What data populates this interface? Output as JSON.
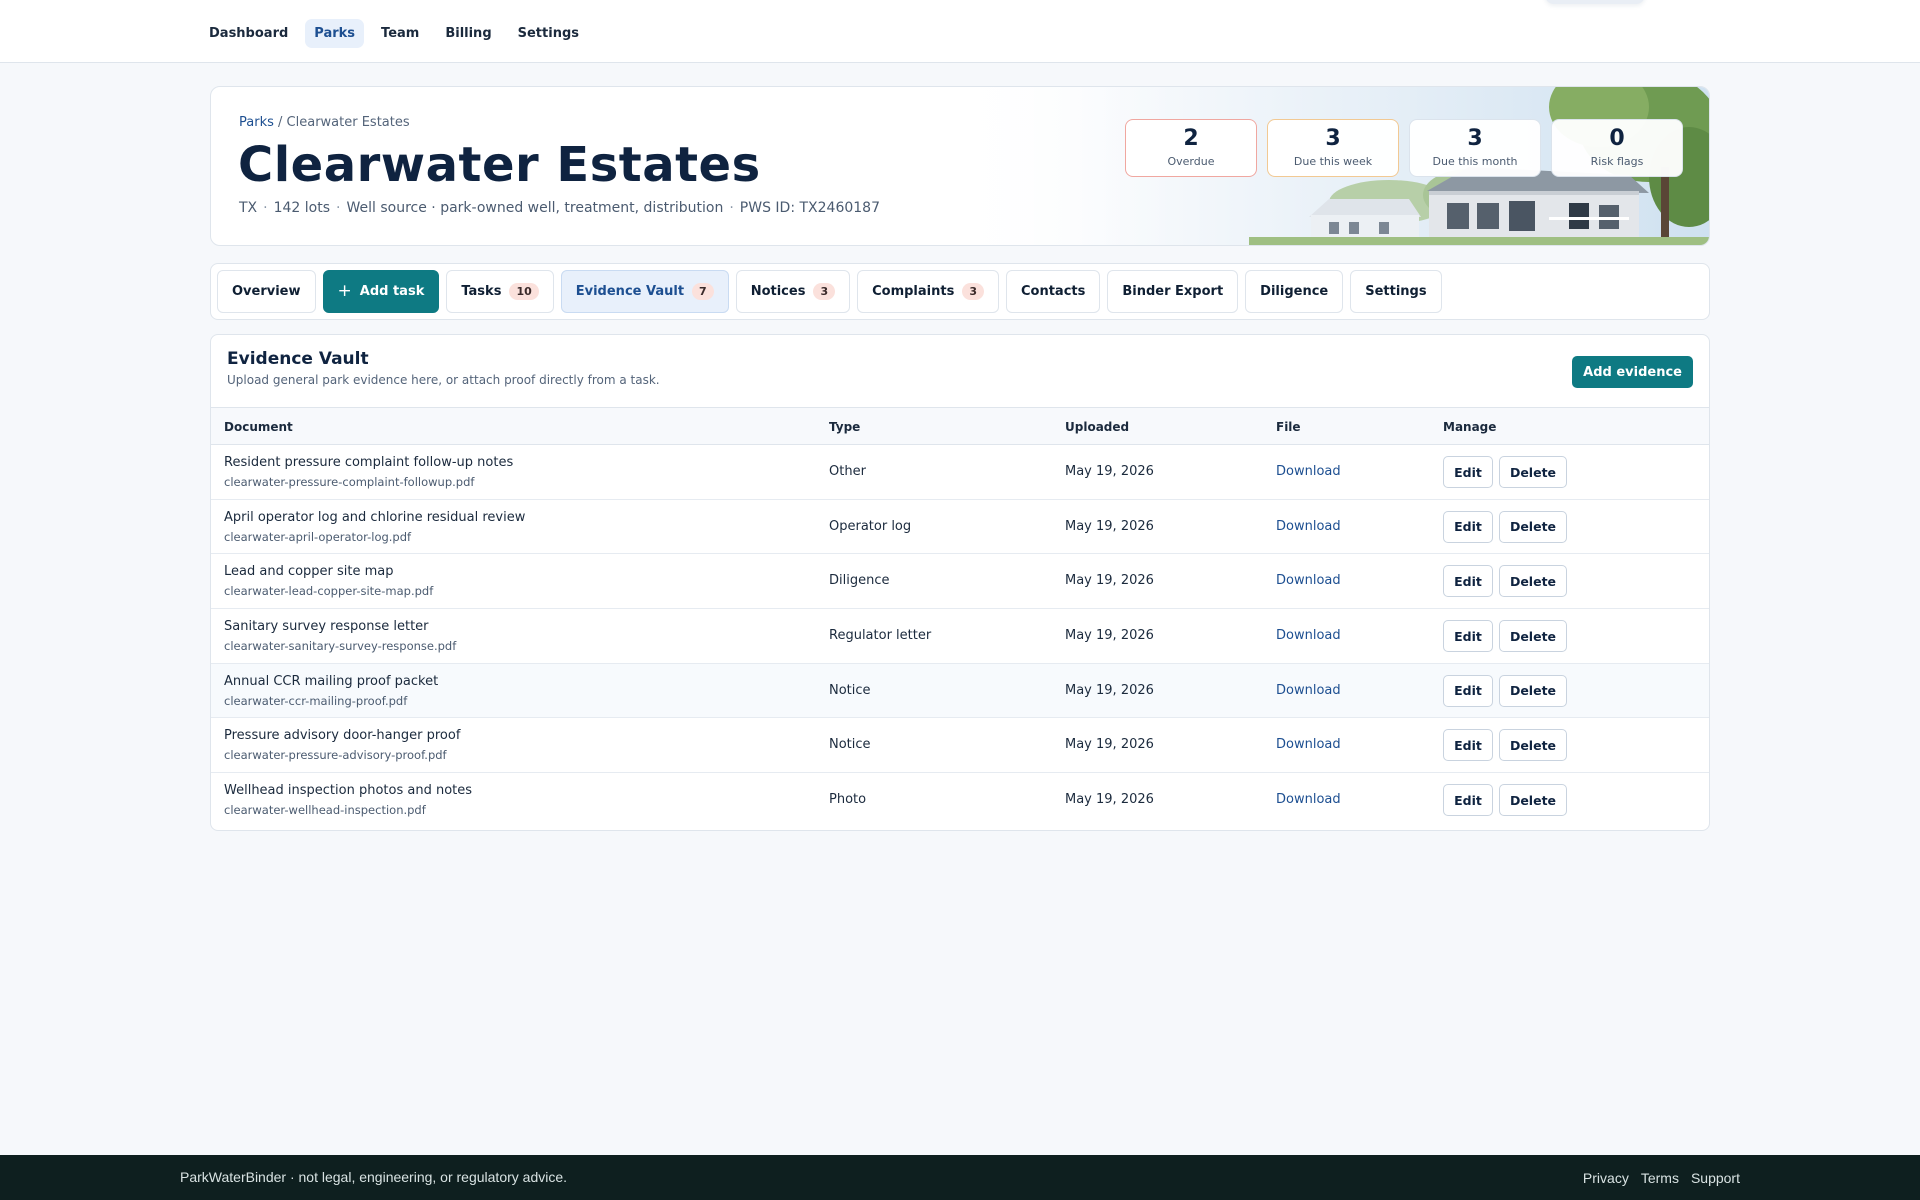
{
  "nav": {
    "items": [
      {
        "label": "Dashboard",
        "active": false
      },
      {
        "label": "Parks",
        "active": true
      },
      {
        "label": "Team",
        "active": false
      },
      {
        "label": "Billing",
        "active": false
      },
      {
        "label": "Settings",
        "active": false
      }
    ]
  },
  "park": {
    "breadcrumb_root": "Parks",
    "breadcrumb_sep": "/",
    "breadcrumb_current": "Clearwater Estates",
    "name": "Clearwater Estates",
    "state": "TX",
    "lots": "142 lots",
    "source": "Well source · park-owned well, treatment, distribution",
    "pws_id": "PWS ID: TX2460187",
    "meta_sep": "·"
  },
  "stats": [
    {
      "value": "2",
      "label": "Overdue",
      "accent": "#f0a7a0"
    },
    {
      "value": "3",
      "label": "Due this week",
      "accent": "#f2c993"
    },
    {
      "value": "3",
      "label": "Due this month",
      "accent": "#dbe3ec"
    },
    {
      "value": "0",
      "label": "Risk flags",
      "accent": "#dbe3ec"
    }
  ],
  "tabs": {
    "overview": "Overview",
    "add_task": "Add task",
    "tasks": "Tasks",
    "tasks_count": "10",
    "evidence": "Evidence Vault",
    "evidence_count": "7",
    "notices": "Notices",
    "notices_count": "3",
    "complaints": "Complaints",
    "complaints_count": "3",
    "contacts": "Contacts",
    "binder": "Binder Export",
    "diligence": "Diligence",
    "settings": "Settings"
  },
  "evidence": {
    "title": "Evidence Vault",
    "subtitle": "Upload general park evidence here, or attach proof directly from a task.",
    "add_label": "Add evidence",
    "columns": [
      "Document",
      "Type",
      "Uploaded",
      "File",
      "Manage"
    ],
    "download_label": "Download",
    "edit_label": "Edit",
    "delete_label": "Delete",
    "rows": [
      {
        "name": "Resident pressure complaint follow-up notes",
        "file": "clearwater-pressure-complaint-followup.pdf",
        "type": "Other",
        "uploaded": "May 19, 2026"
      },
      {
        "name": "April operator log and chlorine residual review",
        "file": "clearwater-april-operator-log.pdf",
        "type": "Operator log",
        "uploaded": "May 19, 2026"
      },
      {
        "name": "Lead and copper site map",
        "file": "clearwater-lead-copper-site-map.pdf",
        "type": "Diligence",
        "uploaded": "May 19, 2026"
      },
      {
        "name": "Sanitary survey response letter",
        "file": "clearwater-sanitary-survey-response.pdf",
        "type": "Regulator letter",
        "uploaded": "May 19, 2026"
      },
      {
        "name": "Annual CCR mailing proof packet",
        "file": "clearwater-ccr-mailing-proof.pdf",
        "type": "Notice",
        "uploaded": "May 19, 2026"
      },
      {
        "name": "Pressure advisory door-hanger proof",
        "file": "clearwater-pressure-advisory-proof.pdf",
        "type": "Notice",
        "uploaded": "May 19, 2026"
      },
      {
        "name": "Wellhead inspection photos and notes",
        "file": "clearwater-wellhead-inspection.pdf",
        "type": "Photo",
        "uploaded": "May 19, 2026"
      }
    ]
  },
  "footer": {
    "text": "ParkWaterBinder · not legal, engineering, or regulatory advice.",
    "links": [
      "Privacy",
      "Terms",
      "Support"
    ]
  },
  "colors": {
    "accent_teal": "#0e7a83",
    "link_blue": "#1d4f91",
    "footer_bg": "#0e1f1f"
  }
}
